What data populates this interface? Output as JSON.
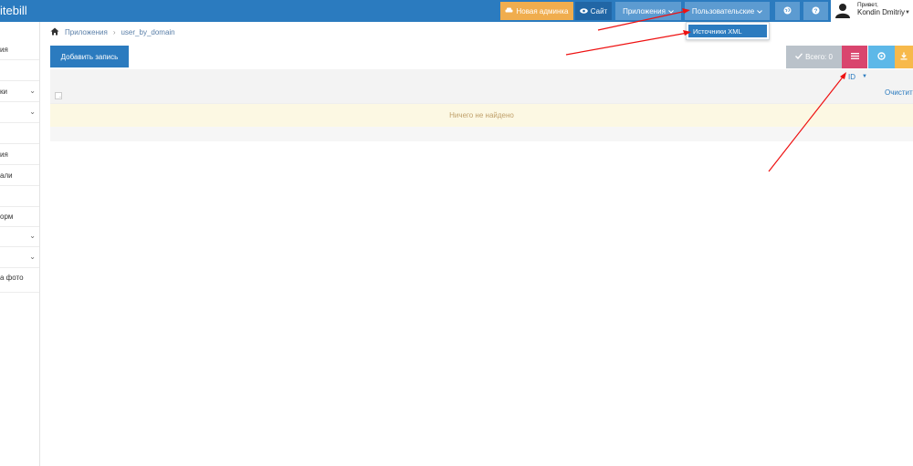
{
  "header": {
    "brand": "itebill",
    "new_admin": "Новая админка",
    "site": "Сайт",
    "apps": "Приложения",
    "users": "Пользовательские",
    "user_greeting": "Привет,",
    "user_name": "Kondin Dmitriy"
  },
  "sidebar": {
    "items": [
      {
        "label": "ия"
      },
      {
        "label": ""
      },
      {
        "label": "ки"
      },
      {
        "label": ""
      },
      {
        "label": ""
      },
      {
        "label": "ия"
      },
      {
        "label": "али"
      },
      {
        "label": ""
      },
      {
        "label": "орм"
      },
      {
        "label": ""
      },
      {
        "label": ""
      },
      {
        "label": "а фото"
      }
    ]
  },
  "breadcrumb": {
    "apps": "Приложения",
    "current": "user_by_domain"
  },
  "toolbar": {
    "add_record": "Добавить запись",
    "total": "Всего: 0"
  },
  "table": {
    "col_id": "ID",
    "filter_placeholder": "...",
    "clear": "Очистить",
    "empty": "Ничего не найдено"
  },
  "dropdown": {
    "item": "Источники XML"
  },
  "colors": {
    "primary": "#2b7bbf",
    "annotation": "#ee1111"
  }
}
